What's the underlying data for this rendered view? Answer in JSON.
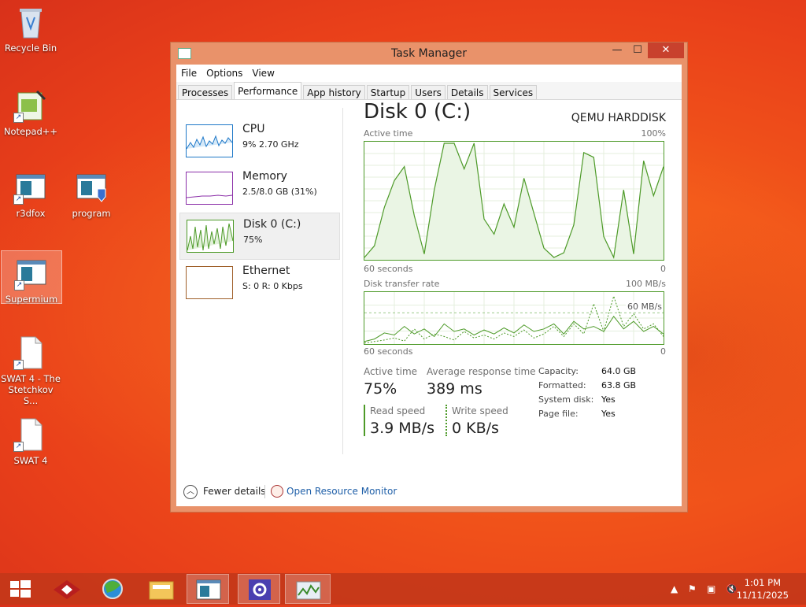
{
  "desktop": {
    "icons": [
      {
        "label": "Recycle Bin"
      },
      {
        "label": "Notepad++"
      },
      {
        "label": "r3dfox"
      },
      {
        "label": "program"
      },
      {
        "label": "Supermium"
      },
      {
        "label": "SWAT 4 - The Stetchkov S..."
      },
      {
        "label": "SWAT 4"
      }
    ]
  },
  "window": {
    "title": "Task Manager",
    "controls": {
      "minimize": "—",
      "maximize": "☐",
      "close": "✕"
    },
    "menu": [
      "File",
      "Options",
      "View"
    ],
    "tabs": [
      "Processes",
      "Performance",
      "App history",
      "Startup",
      "Users",
      "Details",
      "Services"
    ],
    "active_tab": "Performance"
  },
  "perf_list": [
    {
      "name": "CPU",
      "sub": "9%  2.70 GHz",
      "color": "#1e78c8"
    },
    {
      "name": "Memory",
      "sub": "2.5/8.0 GB (31%)",
      "color": "#8b2fa8"
    },
    {
      "name": "Disk 0 (C:)",
      "sub": "75%",
      "color": "#4d9a28"
    },
    {
      "name": "Ethernet",
      "sub": "S: 0  R: 0 Kbps",
      "color": "#a0602a"
    }
  ],
  "detail": {
    "title": "Disk 0 (C:)",
    "model": "QEMU HARDDISK",
    "active_graph": {
      "label": "Active time",
      "max": "100%",
      "left_bottom": "60 seconds",
      "right_bottom": "0"
    },
    "rate_graph": {
      "label": "Disk transfer rate",
      "max": "100 MB/s",
      "mid": "60 MB/s",
      "left_bottom": "60 seconds",
      "right_bottom": "0"
    },
    "stats": {
      "active_time_label": "Active time",
      "active_time": "75%",
      "avg_resp_label": "Average response time",
      "avg_resp": "389 ms",
      "read_label": "Read speed",
      "read": "3.9 MB/s",
      "write_label": "Write speed",
      "write": "0 KB/s"
    },
    "props": [
      {
        "k": "Capacity:",
        "v": "64.0 GB"
      },
      {
        "k": "Formatted:",
        "v": "63.8 GB"
      },
      {
        "k": "System disk:",
        "v": "Yes"
      },
      {
        "k": "Page file:",
        "v": "Yes"
      }
    ]
  },
  "footer": {
    "fewer": "Fewer details",
    "open_rm": "Open Resource Monitor"
  },
  "chart_data": [
    {
      "type": "area",
      "title": "Active time",
      "ylim": [
        0,
        100
      ],
      "x": [
        60,
        58,
        56,
        54,
        52,
        50,
        48,
        46,
        44,
        42,
        40,
        38,
        36,
        34,
        32,
        30,
        28,
        26,
        24,
        22,
        20,
        18,
        16,
        14,
        12,
        10,
        8,
        6,
        4,
        2,
        0
      ],
      "values": [
        2,
        12,
        45,
        68,
        80,
        38,
        5,
        60,
        100,
        100,
        78,
        100,
        35,
        22,
        48,
        28,
        70,
        40,
        10,
        2,
        6,
        30,
        92,
        88,
        20,
        2,
        60,
        5,
        85,
        55,
        80
      ]
    },
    {
      "type": "line",
      "title": "Disk transfer rate",
      "ylim": [
        0,
        100
      ],
      "series": [
        {
          "values": [
            5,
            10,
            22,
            18,
            35,
            20,
            30,
            15,
            40,
            25,
            30,
            18,
            28,
            20,
            32,
            22,
            38,
            25,
            30,
            40,
            20,
            45,
            30,
            35,
            25,
            55,
            30,
            45,
            25,
            35,
            20
          ]
        },
        {
          "values": [
            2,
            5,
            8,
            12,
            6,
            30,
            10,
            20,
            15,
            8,
            25,
            12,
            18,
            10,
            22,
            15,
            28,
            12,
            20,
            35,
            15,
            40,
            20,
            80,
            25,
            95,
            35,
            60,
            30,
            40,
            15
          ]
        }
      ]
    }
  ],
  "taskbar": {
    "clock_time": "1:01 PM",
    "clock_date": "11/11/2025",
    "tray_icons": [
      "show-hidden-icon",
      "action-center-icon",
      "network-icon",
      "volume-mute-icon"
    ]
  }
}
